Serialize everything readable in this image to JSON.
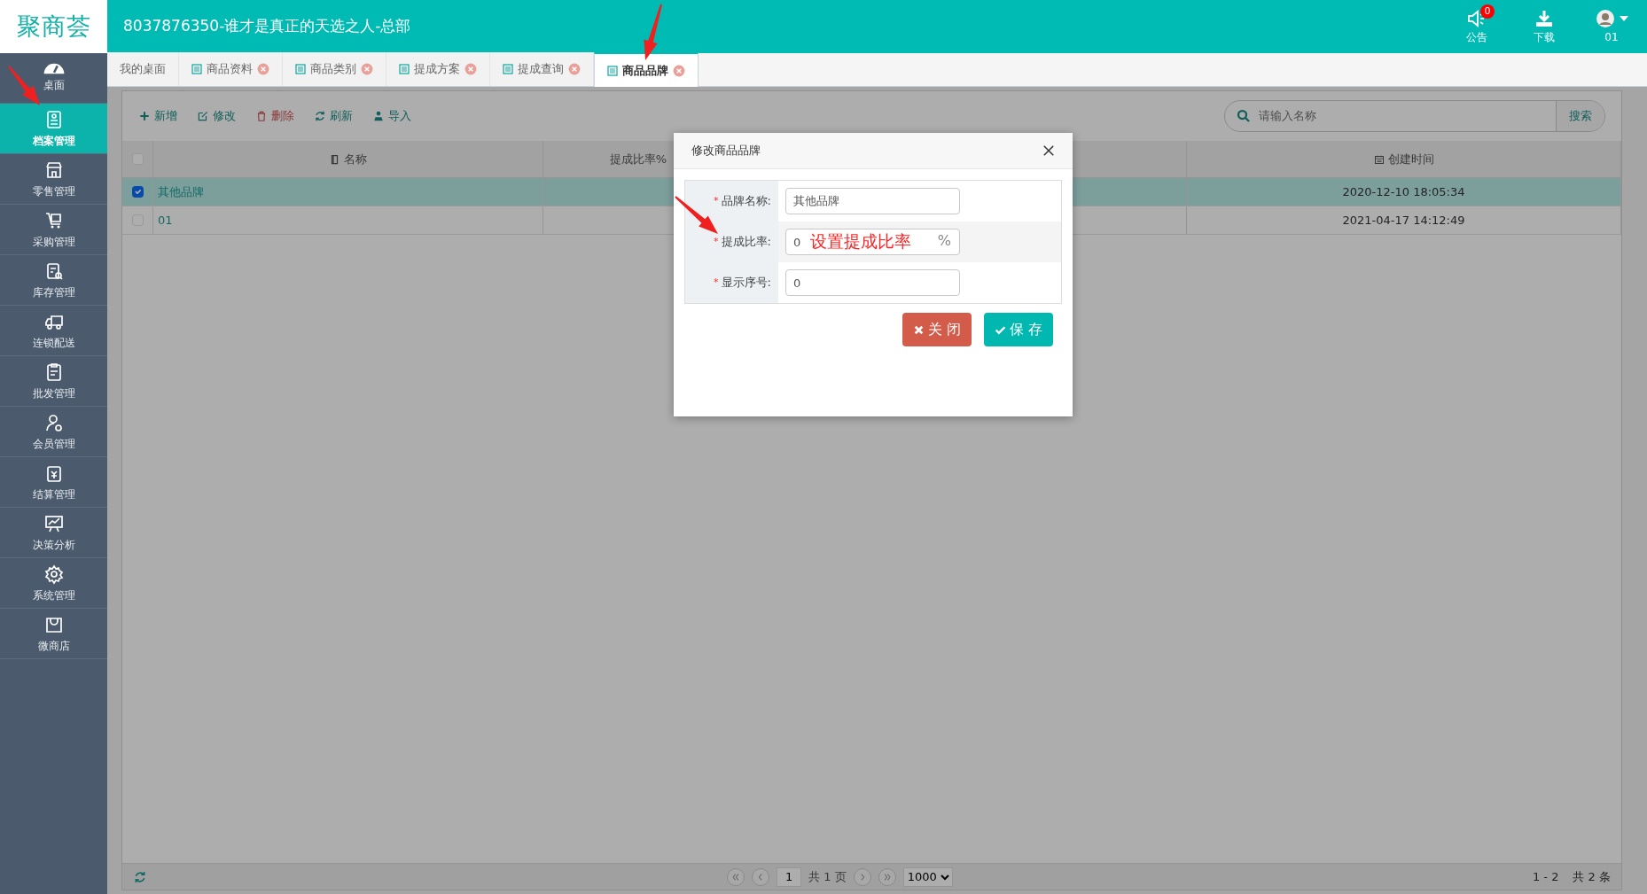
{
  "app": {
    "logo": "聚商荟",
    "title": "8037876350-谁才是真正的天选之人-总部"
  },
  "header_actions": [
    {
      "kind": "notice",
      "label": "公告",
      "badge": "0"
    },
    {
      "kind": "download",
      "label": "下载"
    },
    {
      "kind": "user",
      "label": "01"
    }
  ],
  "sidebar": {
    "items": [
      {
        "label": "桌面",
        "selected": false
      },
      {
        "label": "档案管理",
        "selected": true
      },
      {
        "label": "零售管理",
        "selected": false
      },
      {
        "label": "采购管理",
        "selected": false
      },
      {
        "label": "库存管理",
        "selected": false
      },
      {
        "label": "连锁配送",
        "selected": false
      },
      {
        "label": "批发管理",
        "selected": false
      },
      {
        "label": "会员管理",
        "selected": false
      },
      {
        "label": "结算管理",
        "selected": false
      },
      {
        "label": "决策分析",
        "selected": false
      },
      {
        "label": "系统管理",
        "selected": false
      },
      {
        "label": "微商店",
        "selected": false
      }
    ]
  },
  "tabs": [
    {
      "label": "我的桌面",
      "closable": false,
      "selected": false
    },
    {
      "label": "商品资料",
      "closable": true,
      "selected": false
    },
    {
      "label": "商品类别",
      "closable": true,
      "selected": false
    },
    {
      "label": "提成方案",
      "closable": true,
      "selected": false
    },
    {
      "label": "提成查询",
      "closable": true,
      "selected": false
    },
    {
      "label": "商品品牌",
      "closable": true,
      "selected": true
    }
  ],
  "toolbar": {
    "buttons": [
      {
        "kind": "add",
        "label": "新增"
      },
      {
        "kind": "edit",
        "label": "修改"
      },
      {
        "kind": "delete",
        "label": "删除"
      },
      {
        "kind": "refresh",
        "label": "刷新"
      },
      {
        "kind": "import",
        "label": "导入"
      }
    ],
    "search": {
      "placeholder": "请输入名称",
      "button": "搜索"
    }
  },
  "table": {
    "select_all": {
      "checked": false
    },
    "columns": [
      {
        "label": "名称"
      },
      {
        "label": "提成比率%"
      },
      {
        "label": "创建时间"
      }
    ],
    "rows": [
      {
        "checked": true,
        "selected": true,
        "name": "其他品牌",
        "created": "2020-12-10 18:05:34"
      },
      {
        "checked": false,
        "selected": false,
        "name": "01",
        "created": "2021-04-17 14:12:49"
      }
    ]
  },
  "pager": {
    "page": "1",
    "total_pages": "共 1 页",
    "page_size": "1000",
    "range": "1 - 2",
    "total": "共 2 条"
  },
  "dialog": {
    "title": "修改商品品牌",
    "fields": [
      {
        "marker": "*",
        "label": "品牌名称:",
        "value": "其他品牌"
      },
      {
        "marker": "*",
        "label": "提成比率:",
        "value": "0",
        "suffix": "%",
        "annotation": "设置提成比率"
      },
      {
        "marker": "*",
        "label": "显示序号:",
        "value": "0"
      }
    ],
    "buttons": [
      {
        "kind": "close",
        "label": "关 闭"
      },
      {
        "kind": "save",
        "label": "保 存"
      }
    ]
  }
}
